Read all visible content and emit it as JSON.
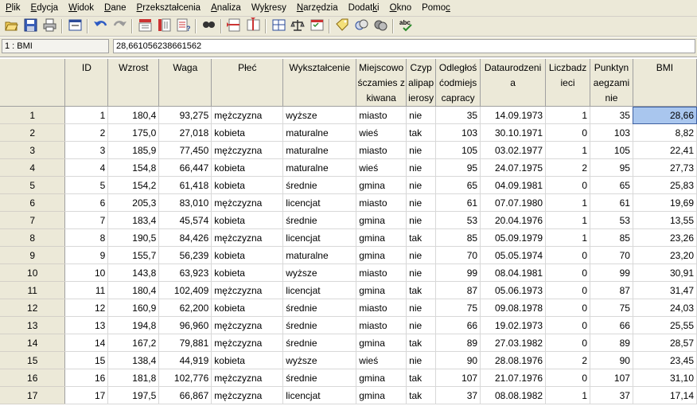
{
  "menu": [
    "Plik",
    "Edycja",
    "Widok",
    "Dane",
    "Przekształcenia",
    "Analiza",
    "Wykresy",
    "Narzędzia",
    "Dodatki",
    "Okno",
    "Pomoc"
  ],
  "menu_accel": [
    0,
    0,
    0,
    0,
    0,
    0,
    2,
    0,
    5,
    0,
    4
  ],
  "toolbar": {
    "icons": [
      [
        "open-icon",
        "save-icon",
        "print-icon"
      ],
      [
        "dialog-recall-icon"
      ],
      [
        "undo-icon",
        "redo-icon"
      ],
      [
        "goto-case-icon",
        "goto-variable-icon",
        "variables-icon"
      ],
      [
        "find-icon"
      ],
      [
        "insert-case-icon",
        "insert-variable-icon"
      ],
      [
        "split-file-icon",
        "weight-cases-icon",
        "select-cases-icon"
      ],
      [
        "value-labels-icon",
        "use-sets-icon",
        "show-all-variables-icon"
      ],
      [
        "spell-check-icon"
      ]
    ]
  },
  "cellbar": {
    "ref": "1 : BMI",
    "value": "28,661056238661562"
  },
  "colors": {
    "panel": "#ece9d8",
    "selection": "#a9c6ee"
  },
  "grid": {
    "headers": [
      "ID",
      "Wzrost",
      "Waga",
      "Płeć",
      "Wykształcenie",
      "Miejscowo śczamies zkiwana",
      "Czyp alipap ierosy",
      "Odległoś ćodmiejs capracy",
      "Dataurodzeni a",
      "Liczbadz ieci",
      "Punktyn aegzami nie",
      "BMI"
    ],
    "rows": [
      [
        "1",
        "1",
        "180,4",
        "93,275",
        "mężczyzna",
        "wyższe",
        "miasto",
        "nie",
        "35",
        "14.09.1973",
        "1",
        "35",
        "28,66"
      ],
      [
        "2",
        "2",
        "175,0",
        "27,018",
        "kobieta",
        "maturalne",
        "wieś",
        "tak",
        "103",
        "30.10.1971",
        "0",
        "103",
        "8,82"
      ],
      [
        "3",
        "3",
        "185,9",
        "77,450",
        "mężczyzna",
        "maturalne",
        "miasto",
        "nie",
        "105",
        "03.02.1977",
        "1",
        "105",
        "22,41"
      ],
      [
        "4",
        "4",
        "154,8",
        "66,447",
        "kobieta",
        "maturalne",
        "wieś",
        "nie",
        "95",
        "24.07.1975",
        "2",
        "95",
        "27,73"
      ],
      [
        "5",
        "5",
        "154,2",
        "61,418",
        "kobieta",
        "średnie",
        "gmina",
        "nie",
        "65",
        "04.09.1981",
        "0",
        "65",
        "25,83"
      ],
      [
        "6",
        "6",
        "205,3",
        "83,010",
        "mężczyzna",
        "licencjat",
        "miasto",
        "nie",
        "61",
        "07.07.1980",
        "1",
        "61",
        "19,69"
      ],
      [
        "7",
        "7",
        "183,4",
        "45,574",
        "kobieta",
        "średnie",
        "gmina",
        "nie",
        "53",
        "20.04.1976",
        "1",
        "53",
        "13,55"
      ],
      [
        "8",
        "8",
        "190,5",
        "84,426",
        "mężczyzna",
        "licencjat",
        "gmina",
        "tak",
        "85",
        "05.09.1979",
        "1",
        "85",
        "23,26"
      ],
      [
        "9",
        "9",
        "155,7",
        "56,239",
        "kobieta",
        "maturalne",
        "gmina",
        "nie",
        "70",
        "05.05.1974",
        "0",
        "70",
        "23,20"
      ],
      [
        "10",
        "10",
        "143,8",
        "63,923",
        "kobieta",
        "wyższe",
        "miasto",
        "nie",
        "99",
        "08.04.1981",
        "0",
        "99",
        "30,91"
      ],
      [
        "11",
        "11",
        "180,4",
        "102,409",
        "mężczyzna",
        "licencjat",
        "gmina",
        "tak",
        "87",
        "05.06.1973",
        "0",
        "87",
        "31,47"
      ],
      [
        "12",
        "12",
        "160,9",
        "62,200",
        "kobieta",
        "średnie",
        "miasto",
        "nie",
        "75",
        "09.08.1978",
        "0",
        "75",
        "24,03"
      ],
      [
        "13",
        "13",
        "194,8",
        "96,960",
        "mężczyzna",
        "średnie",
        "miasto",
        "nie",
        "66",
        "19.02.1973",
        "0",
        "66",
        "25,55"
      ],
      [
        "14",
        "14",
        "167,2",
        "79,881",
        "mężczyzna",
        "średnie",
        "gmina",
        "tak",
        "89",
        "27.03.1982",
        "0",
        "89",
        "28,57"
      ],
      [
        "15",
        "15",
        "138,4",
        "44,919",
        "kobieta",
        "wyższe",
        "wieś",
        "nie",
        "90",
        "28.08.1976",
        "2",
        "90",
        "23,45"
      ],
      [
        "16",
        "16",
        "181,8",
        "102,776",
        "mężczyzna",
        "średnie",
        "gmina",
        "tak",
        "107",
        "21.07.1976",
        "0",
        "107",
        "31,10"
      ],
      [
        "17",
        "17",
        "197,5",
        "66,867",
        "mężczyzna",
        "licencjat",
        "gmina",
        "tak",
        "37",
        "08.08.1982",
        "1",
        "37",
        "17,14"
      ]
    ]
  }
}
